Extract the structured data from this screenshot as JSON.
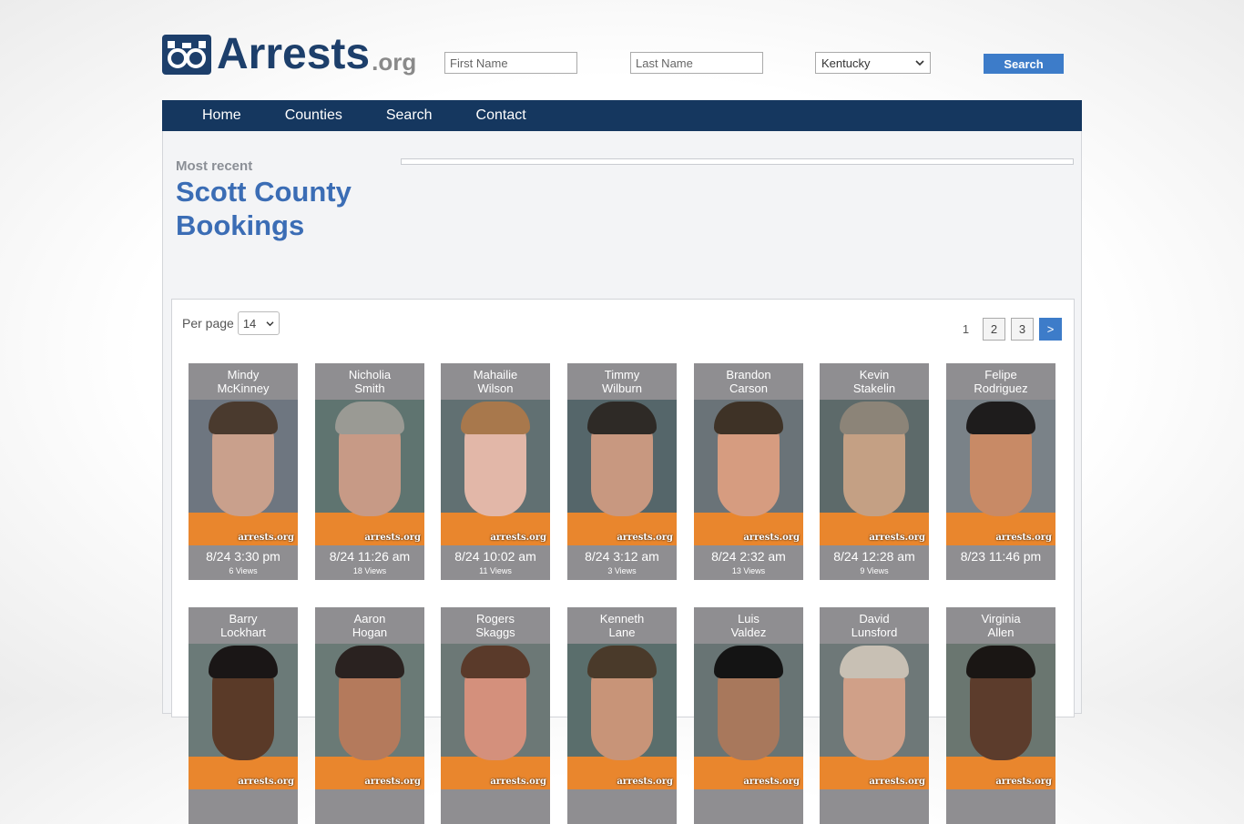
{
  "logo": {
    "name": "Arrests",
    "ext": ".org"
  },
  "search": {
    "first_placeholder": "First Name",
    "last_placeholder": "Last Name",
    "state": "Kentucky",
    "button": "Search"
  },
  "nav": [
    {
      "label": "Home"
    },
    {
      "label": "Counties"
    },
    {
      "label": "Search"
    },
    {
      "label": "Contact"
    }
  ],
  "page": {
    "subtitle": "Most recent",
    "title": "Scott County Bookings"
  },
  "listing": {
    "per_page_label": "Per page",
    "per_page_value": "14",
    "pages": [
      "1",
      "2",
      "3"
    ],
    "next": ">"
  },
  "watermark": "arrests.org",
  "colors": {
    "brand_navy": "#15375f",
    "accent_blue": "#3d7cc9",
    "title_blue": "#3b6db5",
    "card_gray": "#8f8e91",
    "inmate_orange": "#e9862d"
  },
  "bookings": [
    {
      "first": "Mindy",
      "last": "McKinney",
      "time": "8/24 3:30 pm",
      "views": "6 Views"
    },
    {
      "first": "Nicholia",
      "last": "Smith",
      "time": "8/24 11:26 am",
      "views": "18 Views"
    },
    {
      "first": "Mahailie",
      "last": "Wilson",
      "time": "8/24 10:02 am",
      "views": "11 Views"
    },
    {
      "first": "Timmy",
      "last": "Wilburn",
      "time": "8/24 3:12 am",
      "views": "3 Views"
    },
    {
      "first": "Brandon",
      "last": "Carson",
      "time": "8/24 2:32 am",
      "views": "13 Views"
    },
    {
      "first": "Kevin",
      "last": "Stakelin",
      "time": "8/24 12:28 am",
      "views": "9 Views"
    },
    {
      "first": "Felipe",
      "last": "Rodriguez",
      "time": "8/23 11:46 pm",
      "views": ""
    },
    {
      "first": "Barry",
      "last": "Lockhart",
      "time": "",
      "views": ""
    },
    {
      "first": "Aaron",
      "last": "Hogan",
      "time": "",
      "views": ""
    },
    {
      "first": "Rogers",
      "last": "Skaggs",
      "time": "",
      "views": ""
    },
    {
      "first": "Kenneth",
      "last": "Lane",
      "time": "",
      "views": ""
    },
    {
      "first": "Luis",
      "last": "Valdez",
      "time": "",
      "views": ""
    },
    {
      "first": "David",
      "last": "Lunsford",
      "time": "",
      "views": ""
    },
    {
      "first": "Virginia",
      "last": "Allen",
      "time": "",
      "views": ""
    }
  ]
}
